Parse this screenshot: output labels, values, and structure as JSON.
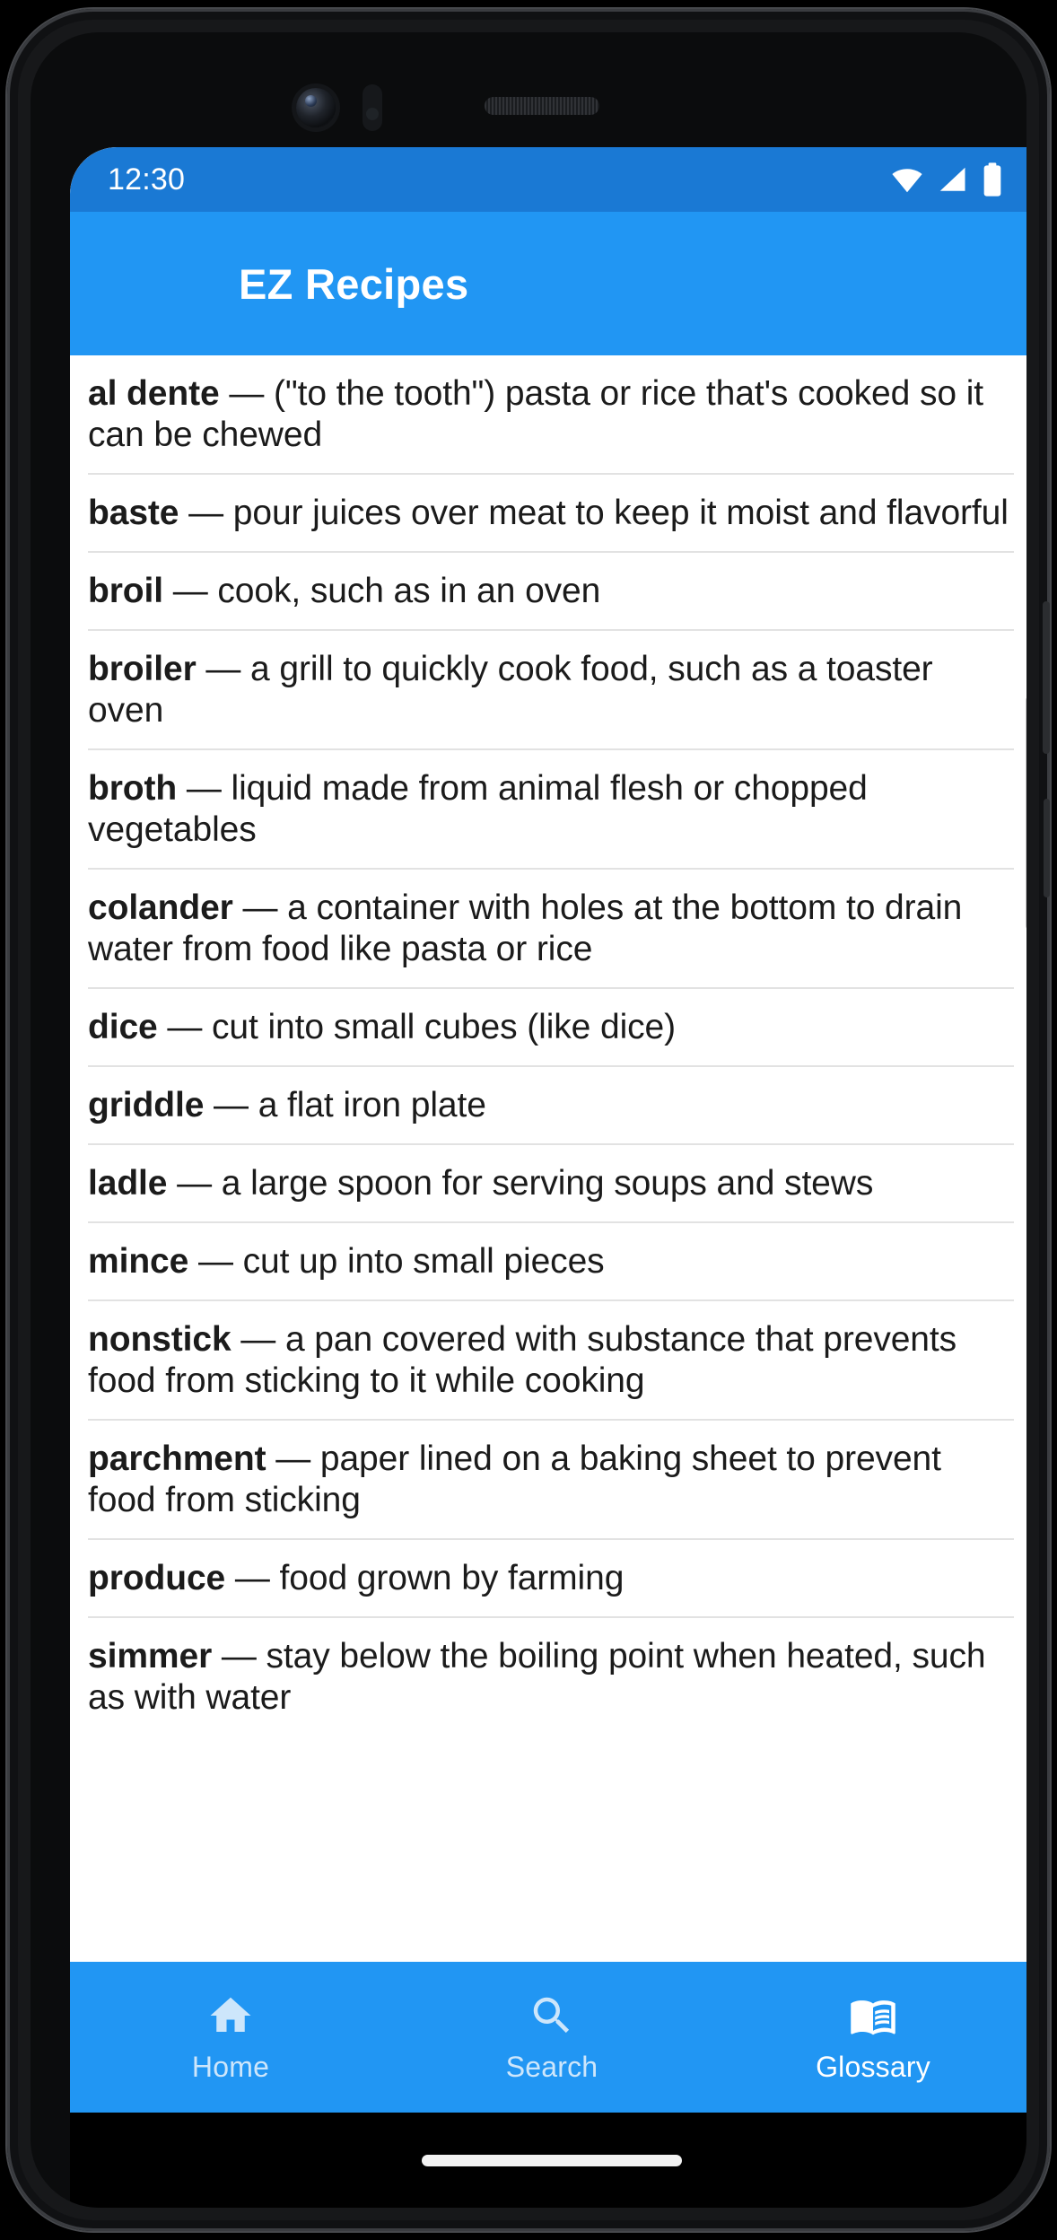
{
  "status_bar": {
    "time": "12:30",
    "icons": [
      "wifi-icon",
      "cellular-signal-icon",
      "battery-icon"
    ],
    "background_color": "#1A79D4",
    "text_color": "#FFFFFF"
  },
  "app_bar": {
    "title": "EZ Recipes",
    "background_color": "#2196F3",
    "text_color": "#FFFFFF"
  },
  "glossary": {
    "items": [
      {
        "term": "al dente",
        "dash": " — ",
        "definition": "(\"to the tooth\") pasta or rice that's cooked so it can be chewed"
      },
      {
        "term": "baste",
        "dash": " — ",
        "definition": "pour juices over meat to keep it moist and flavorful"
      },
      {
        "term": "broil",
        "dash": " — ",
        "definition": "cook, such as in an oven"
      },
      {
        "term": "broiler",
        "dash": " — ",
        "definition": "a grill to quickly cook food, such as a toaster oven"
      },
      {
        "term": "broth",
        "dash": " — ",
        "definition": "liquid made from animal flesh or chopped vegetables"
      },
      {
        "term": "colander",
        "dash": " — ",
        "definition": "a container with holes at the bottom to drain water from food like pasta or rice"
      },
      {
        "term": "dice",
        "dash": " — ",
        "definition": "cut into small cubes (like dice)"
      },
      {
        "term": "griddle",
        "dash": " — ",
        "definition": "a flat iron plate"
      },
      {
        "term": "ladle",
        "dash": " — ",
        "definition": "a large spoon for serving soups and stews"
      },
      {
        "term": "mince",
        "dash": " — ",
        "definition": "cut up into small pieces"
      },
      {
        "term": "nonstick",
        "dash": " — ",
        "definition": "a pan covered with substance that prevents food from sticking to it while cooking"
      },
      {
        "term": "parchment",
        "dash": " — ",
        "definition": "paper lined on a baking sheet to prevent food from sticking"
      },
      {
        "term": "produce",
        "dash": " — ",
        "definition": "food grown by farming"
      },
      {
        "term": "simmer",
        "dash": " — ",
        "definition": "stay below the boiling point when heated, such as with water"
      }
    ]
  },
  "bottom_nav": {
    "background_color": "#2196F3",
    "active_color": "#FFFFFF",
    "inactive_color": "#CDE6FB",
    "items": [
      {
        "label": "Home",
        "icon": "home-icon",
        "active": false
      },
      {
        "label": "Search",
        "icon": "search-icon",
        "active": false
      },
      {
        "label": "Glossary",
        "icon": "menu-book-icon",
        "active": true
      }
    ]
  }
}
